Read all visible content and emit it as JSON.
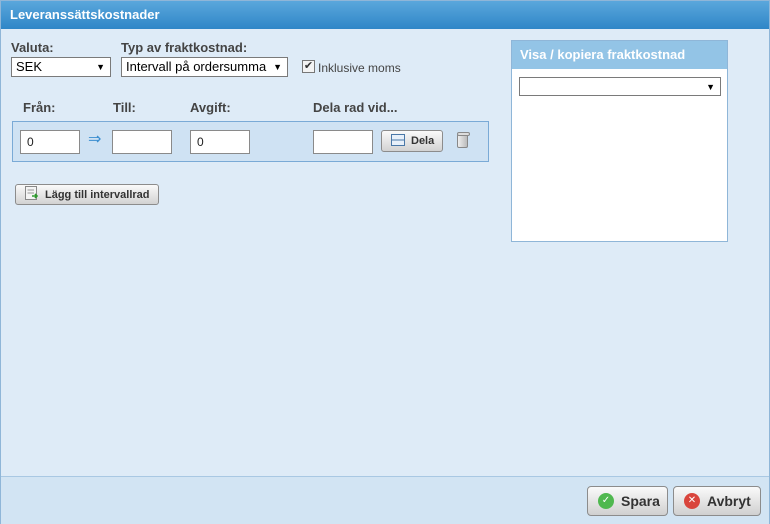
{
  "dialog": {
    "title": "Leveranssättskostnader"
  },
  "currency": {
    "label": "Valuta:",
    "value": "SEK"
  },
  "shipping_type": {
    "label": "Typ av fraktkostnad:",
    "value": "Intervall på ordersumma"
  },
  "including_vat": {
    "label": "Inklusive moms",
    "checked": true
  },
  "columns": {
    "from": "Från:",
    "to": "Till:",
    "fee": "Avgift:",
    "split": "Dela rad vid..."
  },
  "row": {
    "from_value": "0",
    "to_value": "",
    "fee_value": "0",
    "split_value": "",
    "split_button": "Dela"
  },
  "add_row_button": "Lägg till intervallrad",
  "side_panel": {
    "title": "Visa / kopiera fraktkostnad",
    "select_value": ""
  },
  "footer": {
    "save": "Spara",
    "cancel": "Avbryt"
  }
}
